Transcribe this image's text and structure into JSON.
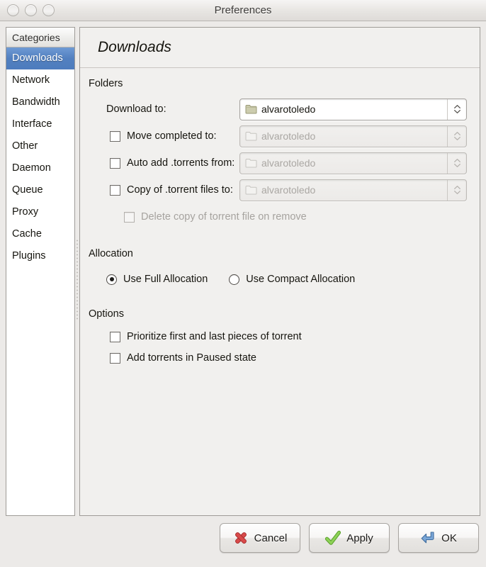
{
  "window": {
    "title": "Preferences",
    "traffic_lights": [
      "close",
      "minimize",
      "zoom"
    ]
  },
  "sidebar": {
    "header": "Categories",
    "selected": "Downloads",
    "items": [
      {
        "label": "Downloads",
        "selected": true
      },
      {
        "label": "Network",
        "selected": false
      },
      {
        "label": "Bandwidth",
        "selected": false
      },
      {
        "label": "Interface",
        "selected": false
      },
      {
        "label": "Other",
        "selected": false
      },
      {
        "label": "Daemon",
        "selected": false
      },
      {
        "label": "Queue",
        "selected": false
      },
      {
        "label": "Proxy",
        "selected": false
      },
      {
        "label": "Cache",
        "selected": false
      },
      {
        "label": "Plugins",
        "selected": false
      }
    ]
  },
  "panel": {
    "title": "Downloads",
    "folders": {
      "group_label": "Folders",
      "download_to": {
        "label": "Download to:",
        "value": "alvarotoledo",
        "enabled": true
      },
      "move_completed_to": {
        "label": "Move completed to:",
        "value": "alvarotoledo",
        "checked": false,
        "enabled": false
      },
      "auto_add_torrents_from": {
        "label": "Auto add .torrents from:",
        "value": "alvarotoledo",
        "checked": false,
        "enabled": false
      },
      "copy_of_torrent_files_to": {
        "label": "Copy of .torrent files to:",
        "value": "alvarotoledo",
        "checked": false,
        "enabled": false
      },
      "delete_copy_on_remove": {
        "label": "Delete copy of torrent file on remove",
        "checked": false,
        "enabled": false
      }
    },
    "allocation": {
      "group_label": "Allocation",
      "options": [
        {
          "label": "Use Full Allocation",
          "selected": true
        },
        {
          "label": "Use Compact Allocation",
          "selected": false
        }
      ]
    },
    "options": {
      "group_label": "Options",
      "items": [
        {
          "label": "Prioritize first and last pieces of torrent",
          "checked": false
        },
        {
          "label": "Add torrents in Paused state",
          "checked": false
        }
      ]
    }
  },
  "buttons": {
    "cancel": {
      "label": "Cancel",
      "icon": "red-x-icon"
    },
    "apply": {
      "label": "Apply",
      "icon": "green-check-icon"
    },
    "ok": {
      "label": "OK",
      "icon": "blue-return-arrow-icon"
    }
  },
  "colors": {
    "selection_blue": "#5280c0",
    "panel_background": "#f1f0ee",
    "window_chrome": "#eceae8",
    "cancel_icon": "#d94a4a",
    "apply_icon": "#74c043",
    "ok_icon": "#6b9bd2"
  }
}
